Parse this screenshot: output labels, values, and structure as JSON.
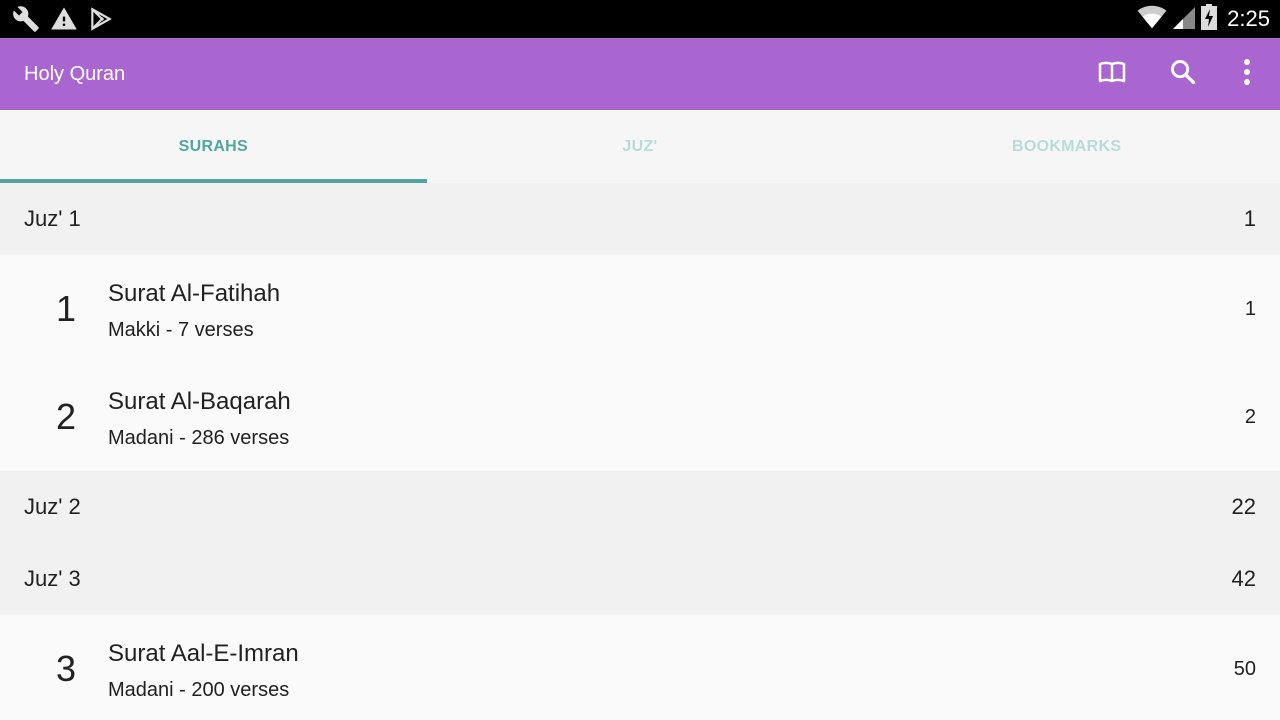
{
  "status_bar": {
    "time": "2:25",
    "left_icons": [
      "wrench-icon",
      "warning-icon",
      "play-store-icon"
    ],
    "right_icons": [
      "wifi-icon",
      "cell-signal-icon",
      "battery-charging-icon"
    ]
  },
  "app_bar": {
    "title": "Holy Quran",
    "actions": [
      "book-icon",
      "search-icon",
      "overflow-menu-icon"
    ],
    "color": "#a966d1"
  },
  "tabs": [
    {
      "label": "SURAHS",
      "active": true
    },
    {
      "label": "JUZ'",
      "active": false
    },
    {
      "label": "BOOKMARKS",
      "active": false
    }
  ],
  "accent_color": "#53a59f",
  "list": {
    "juz1": {
      "title": "Juz' 1",
      "page": "1"
    },
    "surah1": {
      "number": "1",
      "name": "Surat Al-Fatihah",
      "meta": "Makki - 7 verses",
      "page": "1"
    },
    "surah2": {
      "number": "2",
      "name": "Surat Al-Baqarah",
      "meta": "Madani - 286 verses",
      "page": "2"
    },
    "juz2": {
      "title": "Juz' 2",
      "page": "22"
    },
    "juz3": {
      "title": "Juz' 3",
      "page": "42"
    },
    "surah3": {
      "number": "3",
      "name": "Surat Aal-E-Imran",
      "meta": "Madani - 200 verses",
      "page": "50"
    }
  }
}
